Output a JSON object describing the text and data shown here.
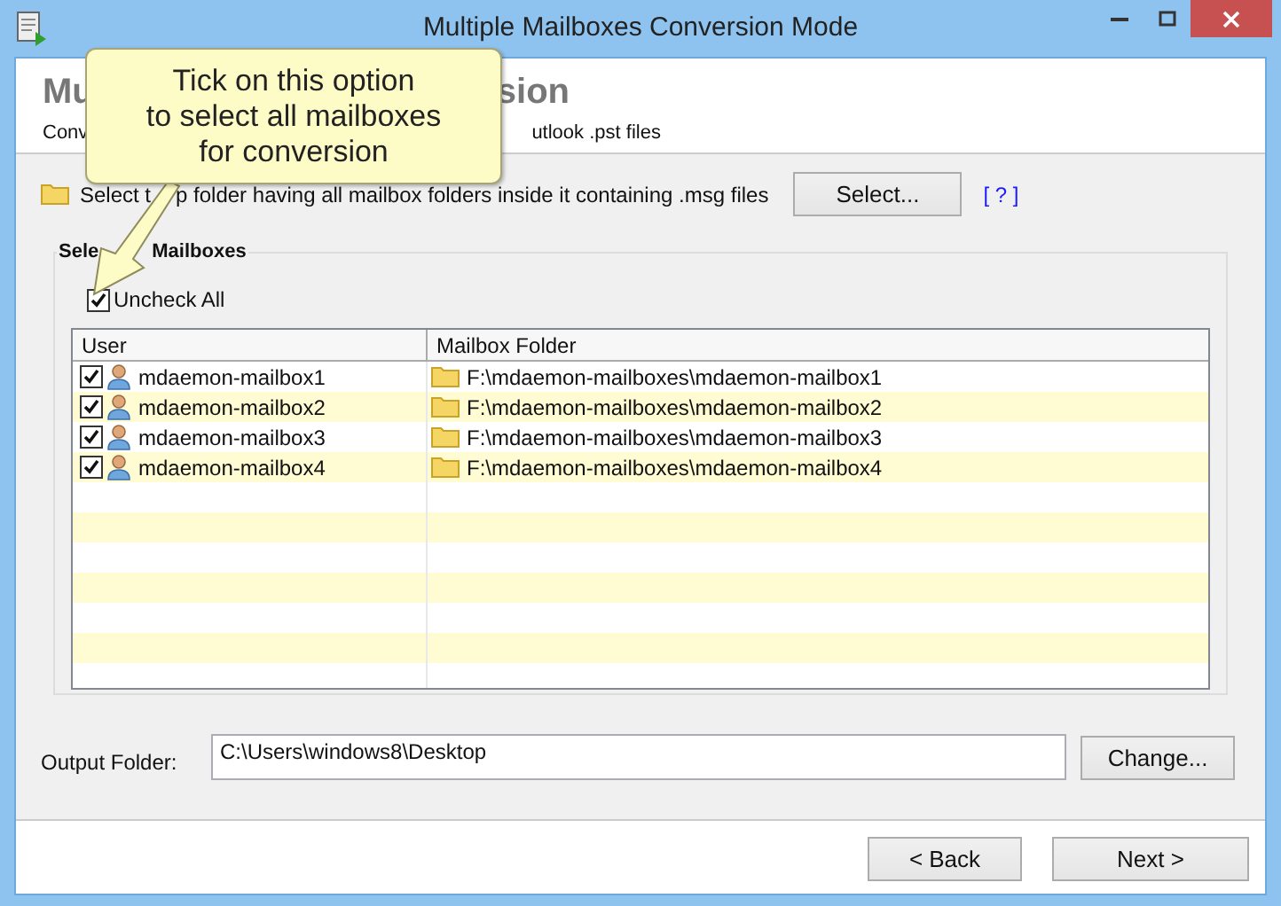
{
  "window": {
    "title": "Multiple Mailboxes Conversion Mode"
  },
  "header": {
    "title_parts": [
      "Mu",
      "sion"
    ],
    "subtitle_parts": [
      "Conv",
      "utlook .pst files"
    ]
  },
  "callout": {
    "lines": [
      "Tick on this option",
      "to select all mailboxes",
      "for conversion"
    ]
  },
  "source": {
    "label_parts": [
      "Select t",
      "p folder having all mailbox folders inside it containing .msg files"
    ],
    "button": "Select...",
    "help": "[ ? ]"
  },
  "mailboxes": {
    "label_parts": [
      "Sele",
      "Mailboxes"
    ],
    "uncheck_all": {
      "label": "Uncheck All",
      "checked": true
    },
    "columns": [
      "User",
      "Mailbox Folder"
    ],
    "rows": [
      {
        "user": "mdaemon-mailbox1",
        "folder": "F:\\mdaemon-mailboxes\\mdaemon-mailbox1",
        "checked": true
      },
      {
        "user": "mdaemon-mailbox2",
        "folder": "F:\\mdaemon-mailboxes\\mdaemon-mailbox2",
        "checked": true
      },
      {
        "user": "mdaemon-mailbox3",
        "folder": "F:\\mdaemon-mailboxes\\mdaemon-mailbox3",
        "checked": true
      },
      {
        "user": "mdaemon-mailbox4",
        "folder": "F:\\mdaemon-mailboxes\\mdaemon-mailbox4",
        "checked": true
      }
    ]
  },
  "output": {
    "label": "Output Folder:",
    "value": "C:\\Users\\windows8\\Desktop",
    "button": "Change..."
  },
  "footer": {
    "buttons": [
      "< Back",
      "Next >"
    ]
  }
}
